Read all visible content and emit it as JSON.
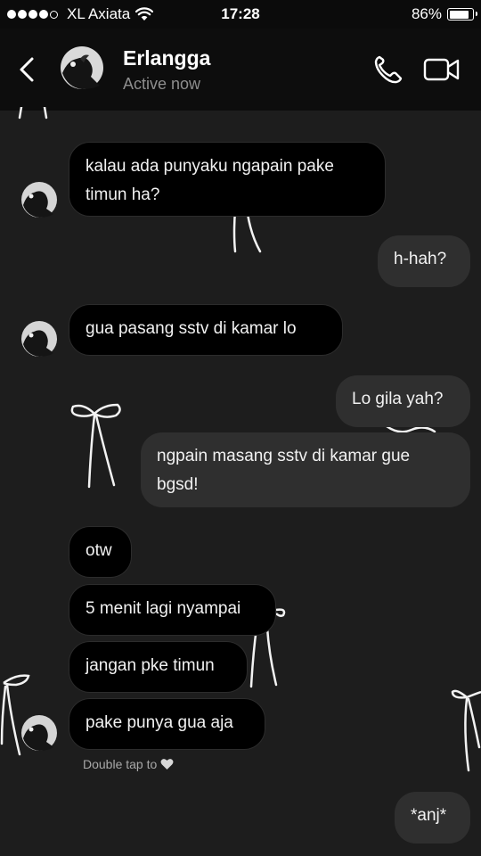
{
  "status_bar": {
    "carrier": "XL Axiata",
    "time": "17:28",
    "battery_percent": "86%",
    "battery_level": 0.86,
    "signal_bars_filled": 4,
    "signal_bars_total": 5
  },
  "header": {
    "contact_name": "Erlangga",
    "contact_status": "Active now"
  },
  "messages": [
    {
      "id": "m1",
      "direction": "incoming",
      "text": "kalau ada punyaku ngapain pake timun ha?"
    },
    {
      "id": "m2",
      "direction": "outgoing",
      "text": "h-hah?"
    },
    {
      "id": "m3",
      "direction": "incoming",
      "text": "gua pasang sstv di kamar lo"
    },
    {
      "id": "m4",
      "direction": "outgoing",
      "text": "Lo gila yah?"
    },
    {
      "id": "m5",
      "direction": "outgoing",
      "text": "ngpain masang sstv di kamar gue bgsd!"
    },
    {
      "id": "m6",
      "direction": "incoming",
      "text": "otw"
    },
    {
      "id": "m7",
      "direction": "incoming",
      "text": "5 menit lagi nyampai"
    },
    {
      "id": "m8",
      "direction": "incoming",
      "text": "jangan pke timun"
    },
    {
      "id": "m9",
      "direction": "incoming",
      "text": "pake punya gua aja"
    },
    {
      "id": "m10",
      "direction": "outgoing",
      "text": "*anj*"
    }
  ],
  "hint": {
    "text": "Double tap to",
    "icon": "heart-icon"
  },
  "colors": {
    "background": "#1d1d1d",
    "header_bg": "#0d0d0d",
    "incoming_bubble": "#000000",
    "outgoing_bubble": "#2f2f2f",
    "secondary_text": "#8e8e8e"
  }
}
